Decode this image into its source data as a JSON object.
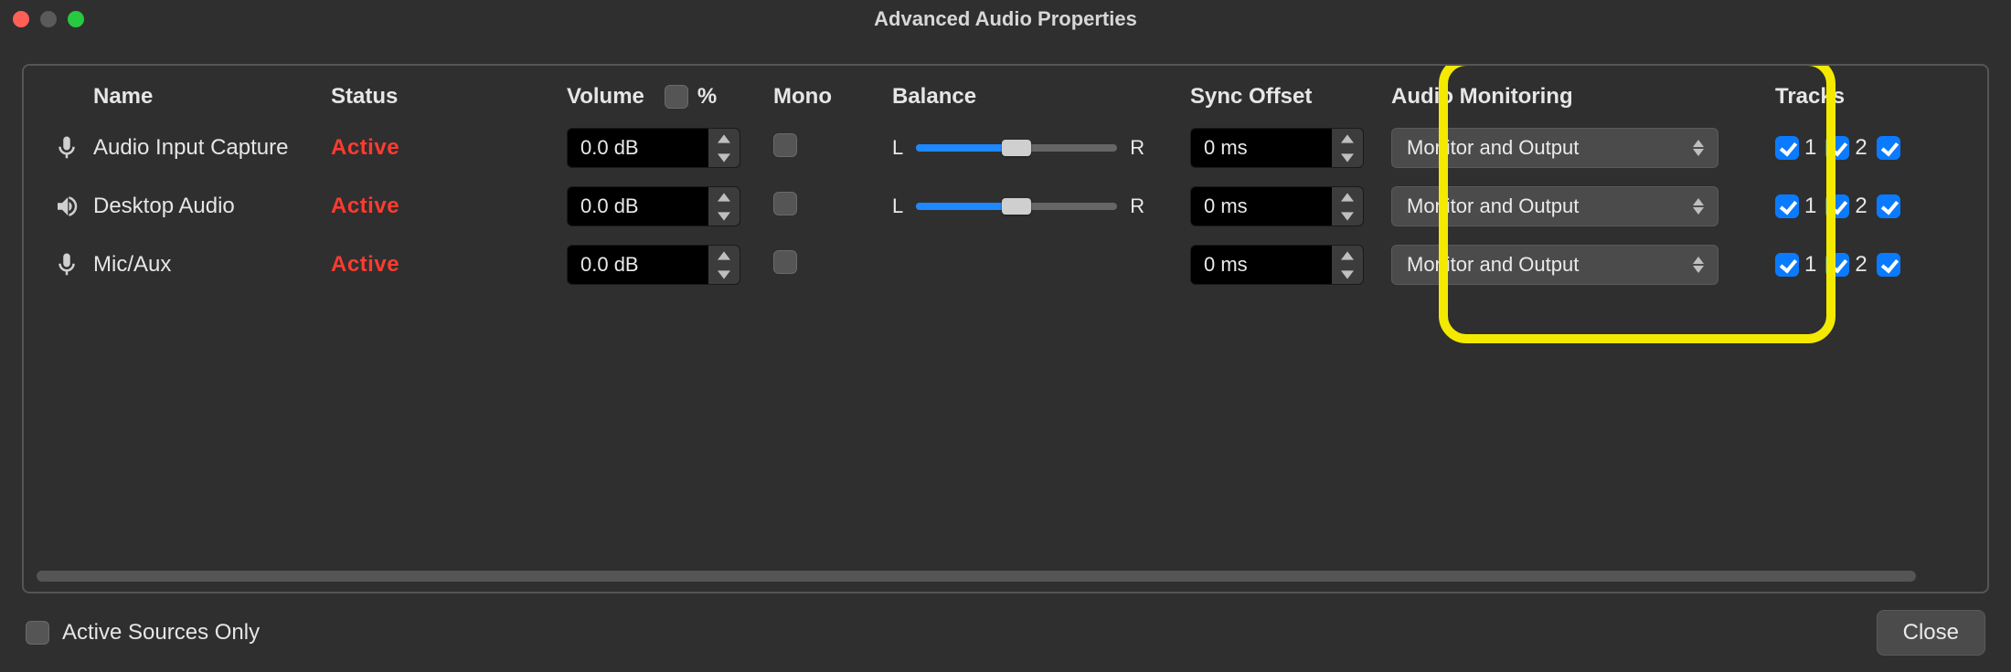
{
  "window": {
    "title": "Advanced Audio Properties"
  },
  "columns": {
    "name": "Name",
    "status": "Status",
    "volume": "Volume",
    "volume_pct": "%",
    "mono": "Mono",
    "balance": "Balance",
    "sync_offset": "Sync Offset",
    "audio_monitoring": "Audio Monitoring",
    "tracks": "Tracks"
  },
  "balance_labels": {
    "left": "L",
    "right": "R"
  },
  "track_labels": [
    "1",
    "2"
  ],
  "rows": [
    {
      "icon": "mic",
      "name": "Audio Input Capture",
      "status": "Active",
      "volume": "0.0 dB",
      "mono": false,
      "has_balance": true,
      "sync_offset": "0 ms",
      "monitoring": "Monitor and Output",
      "tracks": [
        true,
        true
      ]
    },
    {
      "icon": "speaker",
      "name": "Desktop Audio",
      "status": "Active",
      "volume": "0.0 dB",
      "mono": false,
      "has_balance": true,
      "sync_offset": "0 ms",
      "monitoring": "Monitor and Output",
      "tracks": [
        true,
        true
      ]
    },
    {
      "icon": "mic",
      "name": "Mic/Aux",
      "status": "Active",
      "volume": "0.0 dB",
      "mono": false,
      "has_balance": false,
      "sync_offset": "0 ms",
      "monitoring": "Monitor and Output",
      "tracks": [
        true,
        true
      ]
    }
  ],
  "footer": {
    "active_sources_only": "Active Sources Only",
    "active_sources_only_checked": false,
    "close": "Close"
  }
}
